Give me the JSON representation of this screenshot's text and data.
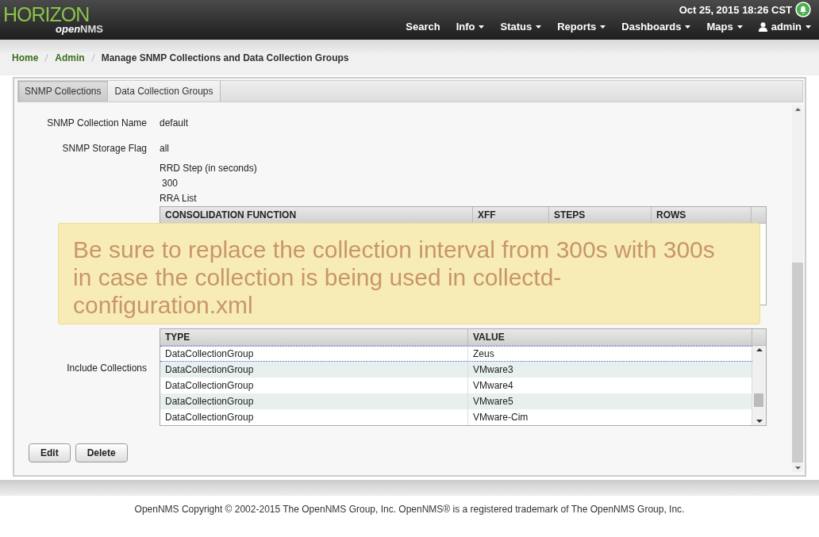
{
  "header": {
    "logo": {
      "main": "HORIZON",
      "sub_prefix": "open",
      "sub_suffix": "NMS"
    },
    "datetime": "Oct 25, 2015 18:26 CST",
    "nav": [
      {
        "label": "Search",
        "kind": "link"
      },
      {
        "label": "Info",
        "kind": "dropdown"
      },
      {
        "label": "Status",
        "kind": "dropdown"
      },
      {
        "label": "Reports",
        "kind": "dropdown"
      },
      {
        "label": "Dashboards",
        "kind": "dropdown"
      },
      {
        "label": "Maps",
        "kind": "dropdown"
      },
      {
        "label": "admin",
        "kind": "user"
      }
    ]
  },
  "breadcrumb": [
    {
      "label": "Home",
      "kind": "link"
    },
    {
      "label": "Admin",
      "kind": "link"
    },
    {
      "label": "Manage SNMP Collections and Data Collection Groups",
      "kind": "current"
    }
  ],
  "tabs": [
    {
      "label": "SNMP Collections",
      "selected": true
    },
    {
      "label": "Data Collection Groups",
      "selected": false
    }
  ],
  "form": {
    "fields": [
      {
        "label": "SNMP Collection Name",
        "value": "default"
      },
      {
        "label": "SNMP Storage Flag",
        "value": "all"
      }
    ],
    "rrd": {
      "step_label": "RRD Step (in seconds)",
      "step": "300",
      "list_label": "RRA List",
      "columns": [
        "CONSOLIDATION FUNCTION",
        "XFF",
        "STEPS",
        "ROWS"
      ]
    },
    "includes": {
      "label": "Include Collections",
      "columns": [
        "TYPE",
        "VALUE"
      ],
      "rows": [
        {
          "cells": [
            "DataCollectionGroup",
            "Zeus"
          ],
          "selected": true
        },
        {
          "cells": [
            "DataCollectionGroup",
            "VMware3"
          ],
          "selected": false
        },
        {
          "cells": [
            "DataCollectionGroup",
            "VMware4"
          ],
          "selected": false
        },
        {
          "cells": [
            "DataCollectionGroup",
            "VMware5"
          ],
          "selected": false
        },
        {
          "cells": [
            "DataCollectionGroup",
            "VMware-Cim"
          ],
          "selected": false
        }
      ]
    }
  },
  "buttons": [
    "Edit",
    "Delete"
  ],
  "notification": "Be sure to replace the collection interval from 300s with 300s in case the collection is being used in collectd-configuration.xml",
  "footer": "OpenNMS Copyright © 2002-2015 The OpenNMS Group, Inc. OpenNMS® is a registered trademark of The OpenNMS Group, Inc."
}
